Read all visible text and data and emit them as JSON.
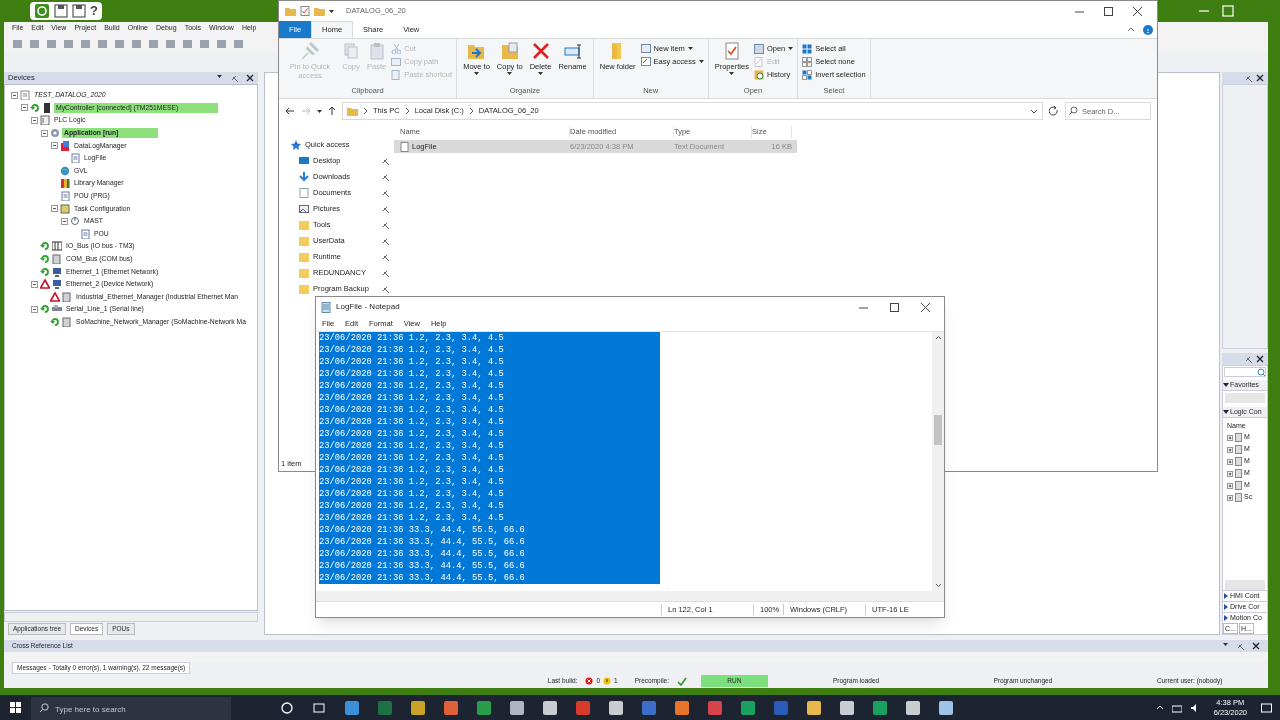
{
  "ide": {
    "help_glyph": "?",
    "menu": [
      "File",
      "Edit",
      "View",
      "Project",
      "Build",
      "Online",
      "Debug",
      "Tools",
      "Window",
      "Help"
    ],
    "devices_panel": {
      "title": "Devices",
      "tree": [
        {
          "label": "TEST_DATALOG_2020",
          "kind": "project",
          "highlighted": false,
          "children": [
            {
              "label": "MyController [connected] (TM251MESE)",
              "kind": "controller",
              "error": false,
              "highlighted": true,
              "children": [
                {
                  "label": "PLC Logic",
                  "kind": "logic",
                  "highlighted": false,
                  "children": [
                    {
                      "label": "Application [run]",
                      "kind": "application",
                      "highlighted": true,
                      "children": [
                        {
                          "label": "DataLogManager",
                          "kind": "manager",
                          "highlighted": false,
                          "children": [
                            {
                              "label": "LogFile",
                              "kind": "file",
                              "highlighted": false
                            }
                          ]
                        },
                        {
                          "label": "GVL",
                          "kind": "globe",
                          "highlighted": false
                        },
                        {
                          "label": "Library Manager",
                          "kind": "library",
                          "highlighted": false
                        },
                        {
                          "label": "POU (PRG)",
                          "kind": "file",
                          "highlighted": false
                        },
                        {
                          "label": "Task Configuration",
                          "kind": "tasks",
                          "highlighted": false,
                          "children": [
                            {
                              "label": "MAST",
                              "kind": "task",
                              "highlighted": false,
                              "children": [
                                {
                                  "label": "POU",
                                  "kind": "file",
                                  "highlighted": false
                                }
                              ]
                            }
                          ]
                        }
                      ]
                    }
                  ]
                },
                {
                  "label": "IO_Bus (IO bus - TM3)",
                  "kind": "bus",
                  "error": false,
                  "highlighted": false
                },
                {
                  "label": "COM_Bus (COM bus)",
                  "kind": "module",
                  "error": false,
                  "highlighted": false
                },
                {
                  "label": "Ethernet_1 (Ethernet Network)",
                  "kind": "network",
                  "error": false,
                  "highlighted": false
                },
                {
                  "label": "Ethernet_2 (Device Network)",
                  "kind": "network",
                  "error": true,
                  "highlighted": false,
                  "children": [
                    {
                      "label": "Industrial_Ethernet_Manager (Industrial Ethernet Man",
                      "kind": "module",
                      "error": true,
                      "highlighted": false
                    }
                  ]
                },
                {
                  "label": "Serial_Line_1 (Serial line)",
                  "kind": "serial",
                  "error": false,
                  "highlighted": false,
                  "children": [
                    {
                      "label": "SoMachine_Network_Manager (SoMachine-Network Ma",
                      "kind": "module",
                      "error": false,
                      "highlighted": false
                    }
                  ]
                }
              ]
            }
          ]
        }
      ]
    },
    "bottom_tabs": [
      {
        "label": "Applications tree",
        "selected": false
      },
      {
        "label": "Devices",
        "selected": true
      },
      {
        "label": "POUs",
        "selected": false
      }
    ],
    "cross_reference": {
      "title": "Cross Reference List"
    },
    "messages": "Messages - Totally 0 error(s), 1 warning(s), 22 message(s)",
    "status_bar": {
      "last_build": "Last build:",
      "errors": "0",
      "warnings": "1",
      "precompile": "Precompile:",
      "run": "RUN",
      "program_loaded": "Program loaded",
      "program_unchanged": "Program unchanged",
      "current_user": "Current user: (nobody)"
    },
    "right_panel": {
      "sections": [
        {
          "label": "Favorites",
          "expanded": true
        },
        {
          "label": "Logic Con",
          "expanded": true
        }
      ],
      "column": "Name",
      "items": [
        "M",
        "M",
        "M",
        "M",
        "M",
        "Sc"
      ],
      "collapsed_sections": [
        "HMI Cont",
        "Drive Cor",
        "Motion Co"
      ],
      "tabs": [
        "C...",
        "H..."
      ]
    }
  },
  "explorer": {
    "title": "DATALOG_06_20",
    "tabs": [
      {
        "label": "File",
        "kind": "file",
        "selected": false
      },
      {
        "label": "Home",
        "kind": "tab",
        "selected": true
      },
      {
        "label": "Share",
        "kind": "tab",
        "selected": false
      },
      {
        "label": "View",
        "kind": "tab",
        "selected": false
      }
    ],
    "groups": [
      {
        "label": "Clipboard",
        "commands": [
          {
            "label": "Pin to Quick access",
            "kind": "large",
            "has_menu": false,
            "disabled": true
          },
          {
            "label": "Copy",
            "kind": "large",
            "has_menu": false,
            "disabled": true
          },
          {
            "label": "Paste",
            "kind": "large",
            "has_menu": false,
            "disabled": true
          },
          {
            "label": "Cut",
            "kind": "small",
            "has_menu": false,
            "disabled": true
          },
          {
            "label": "Copy path",
            "kind": "small",
            "has_menu": false,
            "disabled": true
          },
          {
            "label": "Paste shortcut",
            "kind": "small",
            "has_menu": false,
            "disabled": true
          }
        ]
      },
      {
        "label": "Organize",
        "commands": [
          {
            "label": "Move to",
            "kind": "large",
            "has_menu": true,
            "disabled": false
          },
          {
            "label": "Copy to",
            "kind": "large",
            "has_menu": true,
            "disabled": false
          },
          {
            "label": "Delete",
            "kind": "large",
            "has_menu": true,
            "disabled": false
          },
          {
            "label": "Rename",
            "kind": "large",
            "has_menu": false,
            "disabled": false
          }
        ]
      },
      {
        "label": "New",
        "commands": [
          {
            "label": "New folder",
            "kind": "large",
            "has_menu": false,
            "disabled": false
          },
          {
            "label": "New item",
            "kind": "small",
            "has_menu": true,
            "disabled": false
          },
          {
            "label": "Easy access",
            "kind": "small",
            "has_menu": true,
            "disabled": false
          }
        ]
      },
      {
        "label": "Open",
        "commands": [
          {
            "label": "Properties",
            "kind": "large",
            "has_menu": true,
            "disabled": false
          },
          {
            "label": "Open",
            "kind": "small",
            "has_menu": true,
            "disabled": false
          },
          {
            "label": "Edit",
            "kind": "small",
            "has_menu": false,
            "disabled": true
          },
          {
            "label": "History",
            "kind": "small",
            "has_menu": false,
            "disabled": false
          }
        ]
      },
      {
        "label": "Select",
        "commands": [
          {
            "label": "Select all",
            "kind": "small",
            "has_menu": false,
            "disabled": false
          },
          {
            "label": "Select none",
            "kind": "small",
            "has_menu": false,
            "disabled": false
          },
          {
            "label": "Invert selection",
            "kind": "small",
            "has_menu": false,
            "disabled": false
          }
        ]
      }
    ],
    "path": [
      "This PC",
      "Local Disk (C:)",
      "DATALOG_06_20"
    ],
    "search": {
      "placeholder": "Search D..."
    },
    "nav": [
      {
        "label": "Quick access",
        "kind": "star",
        "pinned": false
      },
      {
        "label": "Desktop",
        "kind": "desktop",
        "pinned": true
      },
      {
        "label": "Downloads",
        "kind": "downloads",
        "pinned": true
      },
      {
        "label": "Documents",
        "kind": "documents",
        "pinned": true
      },
      {
        "label": "Pictures",
        "kind": "pictures",
        "pinned": true
      },
      {
        "label": "Tools",
        "kind": "folder",
        "pinned": true
      },
      {
        "label": "UserData",
        "kind": "folder",
        "pinned": true
      },
      {
        "label": "Runtime",
        "kind": "folder",
        "pinned": true
      },
      {
        "label": "REDUNDANCY",
        "kind": "folder",
        "pinned": true
      },
      {
        "label": "Program Backup",
        "kind": "folder",
        "pinned": true
      }
    ],
    "columns": [
      "Name",
      "Date modified",
      "Type",
      "Size"
    ],
    "rows": [
      {
        "name": "LogFile",
        "date": "6/23/2020 4:38 PM",
        "type": "Text Document",
        "size": "16 KB",
        "selected": true
      }
    ],
    "status": "1 item"
  },
  "notepad": {
    "title": "LogFile - Notepad",
    "menu": [
      "File",
      "Edit",
      "Format",
      "View",
      "Help"
    ],
    "lines": [
      {
        "text": "23/06/2020 21:36 1.2, 2.3, 3.4, 4.5",
        "selected": true
      },
      {
        "text": "23/06/2020 21:36 1.2, 2.3, 3.4, 4.5",
        "selected": true
      },
      {
        "text": "23/06/2020 21:36 1.2, 2.3, 3.4, 4.5",
        "selected": true
      },
      {
        "text": "23/06/2020 21:36 1.2, 2.3, 3.4, 4.5",
        "selected": true
      },
      {
        "text": "23/06/2020 21:36 1.2, 2.3, 3.4, 4.5",
        "selected": true
      },
      {
        "text": "23/06/2020 21:36 1.2, 2.3, 3.4, 4.5",
        "selected": true
      },
      {
        "text": "23/06/2020 21:36 1.2, 2.3, 3.4, 4.5",
        "selected": true
      },
      {
        "text": "23/06/2020 21:36 1.2, 2.3, 3.4, 4.5",
        "selected": true
      },
      {
        "text": "23/06/2020 21:36 1.2, 2.3, 3.4, 4.5",
        "selected": true
      },
      {
        "text": "23/06/2020 21:36 1.2, 2.3, 3.4, 4.5",
        "selected": true
      },
      {
        "text": "23/06/2020 21:36 1.2, 2.3, 3.4, 4.5",
        "selected": true
      },
      {
        "text": "23/06/2020 21:36 1.2, 2.3, 3.4, 4.5",
        "selected": true
      },
      {
        "text": "23/06/2020 21:36 1.2, 2.3, 3.4, 4.5",
        "selected": true
      },
      {
        "text": "23/06/2020 21:36 1.2, 2.3, 3.4, 4.5",
        "selected": true
      },
      {
        "text": "23/06/2020 21:36 1.2, 2.3, 3.4, 4.5",
        "selected": true
      },
      {
        "text": "23/06/2020 21:36 1.2, 2.3, 3.4, 4.5",
        "selected": true
      },
      {
        "text": "23/06/2020 21:36 33.3, 44.4, 55.5, 66.6",
        "selected": true
      },
      {
        "text": "23/06/2020 21:36 33.3, 44.4, 55.5, 66.6",
        "selected": true
      },
      {
        "text": "23/06/2020 21:36 33.3, 44.4, 55.5, 66.6",
        "selected": true
      },
      {
        "text": "23/06/2020 21:36 33.3, 44.4, 55.5, 66.6",
        "selected": true
      },
      {
        "text": "23/06/2020 21:36 33.3, 44.4, 55.5, 66.6",
        "selected": true
      }
    ],
    "status": [
      "Ln 122, Col 1",
      "100%",
      "Windows (CRLF)",
      "UTF-16 LE"
    ]
  },
  "taskbar": {
    "search": {
      "placeholder": "Type here to search"
    },
    "apps": [
      {
        "color": "#3b8ed8"
      },
      {
        "color": "#1e7145"
      },
      {
        "color": "#c9a227"
      },
      {
        "color": "#e0603a"
      },
      {
        "color": "#2a9d4a"
      },
      {
        "color": "#b0b6bf"
      },
      {
        "color": "#c9ccd1"
      },
      {
        "color": "#d83b2b"
      },
      {
        "color": "#c9ccd1"
      },
      {
        "color": "#3b6fc9"
      },
      {
        "color": "#e8742a"
      },
      {
        "color": "#d9434a"
      },
      {
        "color": "#19a15f"
      },
      {
        "color": "#2b5bb8"
      },
      {
        "color": "#e8b84a"
      },
      {
        "color": "#c9ccd1"
      },
      {
        "color": "#19a15f"
      },
      {
        "color": "#c9ccd1"
      },
      {
        "color": "#9fc3e6"
      }
    ],
    "time": "4:38 PM",
    "date": "6/23/2020"
  }
}
